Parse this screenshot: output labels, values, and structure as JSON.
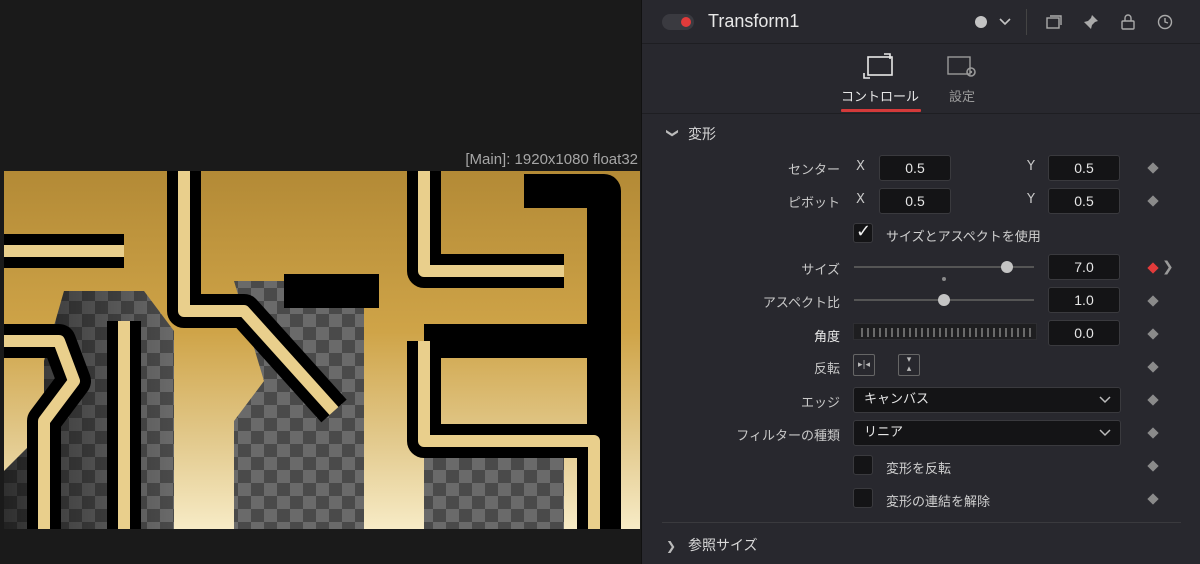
{
  "viewer": {
    "info": "[Main]: 1920x1080 float32"
  },
  "inspector": {
    "node_title": "Transform1",
    "tabs": [
      {
        "label": "コントロール",
        "active": true
      },
      {
        "label": "設定",
        "active": false
      }
    ],
    "section_transform": {
      "label": "変形",
      "center": {
        "label": "センター",
        "x_axis": "X",
        "x": "0.5",
        "y_axis": "Y",
        "y": "0.5"
      },
      "pivot": {
        "label": "ピボット",
        "x_axis": "X",
        "x": "0.5",
        "y_axis": "Y",
        "y": "0.5"
      },
      "use_size_aspect": {
        "label": "サイズとアスペクトを使用",
        "checked": true
      },
      "size": {
        "label": "サイズ",
        "value": "7.0",
        "slider_fraction": 0.85
      },
      "aspect": {
        "label": "アスペクト比",
        "value": "1.0",
        "slider_fraction": 0.5
      },
      "angle": {
        "label": "角度",
        "value": "0.0"
      },
      "flip": {
        "label": "反転"
      },
      "edge": {
        "label": "エッジ",
        "value": "キャンバス"
      },
      "filter": {
        "label": "フィルターの種類",
        "value": "リニア"
      },
      "invert": {
        "label": "変形を反転",
        "checked": false
      },
      "unlink": {
        "label": "変形の連結を解除",
        "checked": false
      }
    },
    "section_reference": {
      "label": "参照サイズ"
    }
  },
  "colors": {
    "accent_red": "#e23b3b",
    "panel_bg": "#28282e",
    "field_bg": "#141416"
  }
}
